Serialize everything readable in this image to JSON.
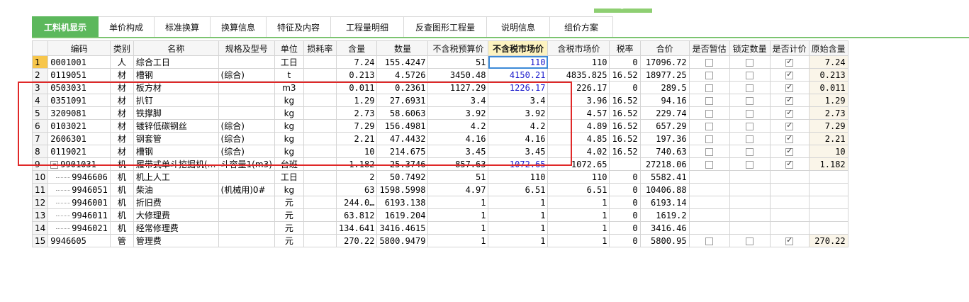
{
  "tabs": [
    {
      "label": "工料机显示",
      "active": true
    },
    {
      "label": "单价构成"
    },
    {
      "label": "标准换算"
    },
    {
      "label": "换算信息"
    },
    {
      "label": "特征及内容"
    },
    {
      "label": "工程量明细"
    },
    {
      "label": "反查图形工程量"
    },
    {
      "label": "说明信息"
    },
    {
      "label": "组价方案"
    }
  ],
  "columns": [
    "编码",
    "类别",
    "名称",
    "规格及型号",
    "单位",
    "损耗率",
    "含量",
    "数量",
    "不含税预算价",
    "不含税市场价",
    "含税市场价",
    "税率",
    "合价",
    "是否暂估",
    "锁定数量",
    "是否计价",
    "原始含量"
  ],
  "rows": [
    {
      "n": "1",
      "code": "0001001",
      "cat": "人",
      "name": "综合工日",
      "spec": "",
      "unit": "工日",
      "loss": "",
      "qty": "7.24",
      "amt": "155.4247",
      "pre": "51",
      "mkt": "110",
      "mktin": "110",
      "tax": "0",
      "total": "17096.72",
      "est": false,
      "lock": false,
      "price": true,
      "orig": "7.24"
    },
    {
      "n": "2",
      "code": "0119051",
      "cat": "材",
      "name": "槽钢",
      "spec": "(综合)",
      "unit": "t",
      "loss": "",
      "qty": "0.213",
      "amt": "4.5726",
      "pre": "3450.48",
      "mkt": "4150.21",
      "mktin": "4835.825",
      "tax": "16.52",
      "total": "18977.25",
      "est": false,
      "lock": false,
      "price": true,
      "orig": "0.213"
    },
    {
      "n": "3",
      "code": "0503031",
      "cat": "材",
      "name": "板方材",
      "spec": "",
      "unit": "m3",
      "loss": "",
      "qty": "0.011",
      "amt": "0.2361",
      "pre": "1127.29",
      "mkt": "1226.17",
      "mktin": "226.17",
      "tax": "0",
      "total": "289.5",
      "est": false,
      "lock": false,
      "price": true,
      "orig": "0.011"
    },
    {
      "n": "4",
      "code": "0351091",
      "cat": "材",
      "name": "扒钉",
      "spec": "",
      "unit": "kg",
      "loss": "",
      "qty": "1.29",
      "amt": "27.6931",
      "pre": "3.4",
      "mkt": "3.4",
      "mktin": "3.96",
      "tax": "16.52",
      "total": "94.16",
      "est": false,
      "lock": false,
      "price": true,
      "orig": "1.29"
    },
    {
      "n": "5",
      "code": "3209081",
      "cat": "材",
      "name": "铁撑脚",
      "spec": "",
      "unit": "kg",
      "loss": "",
      "qty": "2.73",
      "amt": "58.6063",
      "pre": "3.92",
      "mkt": "3.92",
      "mktin": "4.57",
      "tax": "16.52",
      "total": "229.74",
      "est": false,
      "lock": false,
      "price": true,
      "orig": "2.73"
    },
    {
      "n": "6",
      "code": "0103021",
      "cat": "材",
      "name": "镀锌低碳钢丝",
      "spec": "(综合)",
      "unit": "kg",
      "loss": "",
      "qty": "7.29",
      "amt": "156.4981",
      "pre": "4.2",
      "mkt": "4.2",
      "mktin": "4.89",
      "tax": "16.52",
      "total": "657.29",
      "est": false,
      "lock": false,
      "price": true,
      "orig": "7.29"
    },
    {
      "n": "7",
      "code": "2606301",
      "cat": "材",
      "name": "钢套管",
      "spec": "(综合)",
      "unit": "kg",
      "loss": "",
      "qty": "2.21",
      "amt": "47.4432",
      "pre": "4.16",
      "mkt": "4.16",
      "mktin": "4.85",
      "tax": "16.52",
      "total": "197.36",
      "est": false,
      "lock": false,
      "price": true,
      "orig": "2.21"
    },
    {
      "n": "8",
      "code": "0119021",
      "cat": "材",
      "name": "槽钢",
      "spec": "(综合)",
      "unit": "kg",
      "loss": "",
      "qty": "10",
      "amt": "214.675",
      "pre": "3.45",
      "mkt": "3.45",
      "mktin": "4.02",
      "tax": "16.52",
      "total": "740.63",
      "est": false,
      "lock": false,
      "price": true,
      "orig": "10"
    },
    {
      "n": "9",
      "code": "9901031",
      "cat": "机",
      "name": "履带式单斗挖掘机(…",
      "spec": "斗容量1(m3)",
      "unit": "台班",
      "loss": "",
      "qty": "1.182",
      "amt": "25.3746",
      "pre": "857.63",
      "mkt": "1072.65",
      "mktin": "1072.65",
      "tax": "",
      "total": "27218.06",
      "est": false,
      "lock": false,
      "price": true,
      "orig": "1.182",
      "toggle": "−"
    },
    {
      "n": "10",
      "code": "9946606",
      "cat": "机",
      "name": "机上人工",
      "spec": "",
      "unit": "工日",
      "loss": "",
      "qty": "2",
      "amt": "50.7492",
      "pre": "51",
      "mkt": "110",
      "mktin": "110",
      "tax": "0",
      "total": "5582.41",
      "child": true
    },
    {
      "n": "11",
      "code": "9946051",
      "cat": "机",
      "name": "柴油",
      "spec": "(机械用)0#",
      "unit": "kg",
      "loss": "",
      "qty": "63",
      "amt": "1598.5998",
      "pre": "4.97",
      "mkt": "6.51",
      "mktin": "6.51",
      "tax": "0",
      "total": "10406.88",
      "child": true
    },
    {
      "n": "12",
      "code": "9946001",
      "cat": "机",
      "name": "折旧费",
      "spec": "",
      "unit": "元",
      "loss": "",
      "qty": "244.0…",
      "amt": "6193.138",
      "pre": "1",
      "mkt": "1",
      "mktin": "1",
      "tax": "0",
      "total": "6193.14",
      "child": true
    },
    {
      "n": "13",
      "code": "9946011",
      "cat": "机",
      "name": "大修理费",
      "spec": "",
      "unit": "元",
      "loss": "",
      "qty": "63.812",
      "amt": "1619.204",
      "pre": "1",
      "mkt": "1",
      "mktin": "1",
      "tax": "0",
      "total": "1619.2",
      "child": true
    },
    {
      "n": "14",
      "code": "9946021",
      "cat": "机",
      "name": "经常修理费",
      "spec": "",
      "unit": "元",
      "loss": "",
      "qty": "134.641",
      "amt": "3416.4615",
      "pre": "1",
      "mkt": "1",
      "mktin": "1",
      "tax": "0",
      "total": "3416.46",
      "child": true
    },
    {
      "n": "15",
      "code": "9946605",
      "cat": "管",
      "name": "管理费",
      "spec": "",
      "unit": "元",
      "loss": "",
      "qty": "270.22",
      "amt": "5800.9479",
      "pre": "1",
      "mkt": "1",
      "mktin": "1",
      "tax": "0",
      "total": "5800.95",
      "est": false,
      "lock": false,
      "price": true,
      "orig": "270.22"
    }
  ],
  "colors": {
    "accent": "#5cb85c",
    "highlight": "#e02828",
    "blueValue": "#1a1acc",
    "selectedRow": "#f7c64b"
  }
}
